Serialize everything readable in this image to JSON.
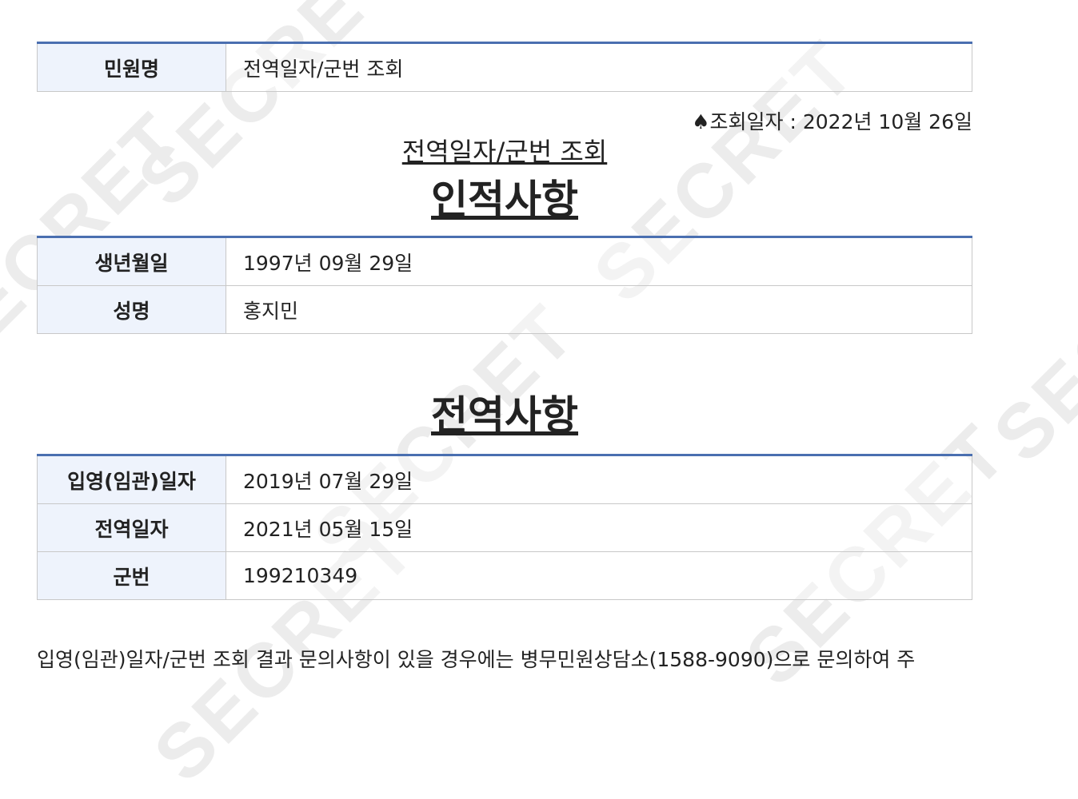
{
  "watermark": "SECRET",
  "request": {
    "label": "민원명",
    "value": "전역일자/군번 조회"
  },
  "query_date": "♠조회일자 : 2022년 10월 26일",
  "subtitle": "전역일자/군번 조회",
  "personal": {
    "title": "인적사항",
    "rows": [
      {
        "label": "생년월일",
        "value": "1997년 09월 29일"
      },
      {
        "label": "성명",
        "value": "홍지민"
      }
    ]
  },
  "service": {
    "title": "전역사항",
    "rows": [
      {
        "label": "입영(임관)일자",
        "value": "2019년 07월 29일"
      },
      {
        "label": "전역일자",
        "value": "2021년 05월 15일"
      },
      {
        "label": "군번",
        "value": "199210349"
      }
    ]
  },
  "notice": "입영(임관)일자/군번 조회 결과 문의사항이 있을 경우에는 병무민원상담소(1588-9090)으로 문의하여 주"
}
